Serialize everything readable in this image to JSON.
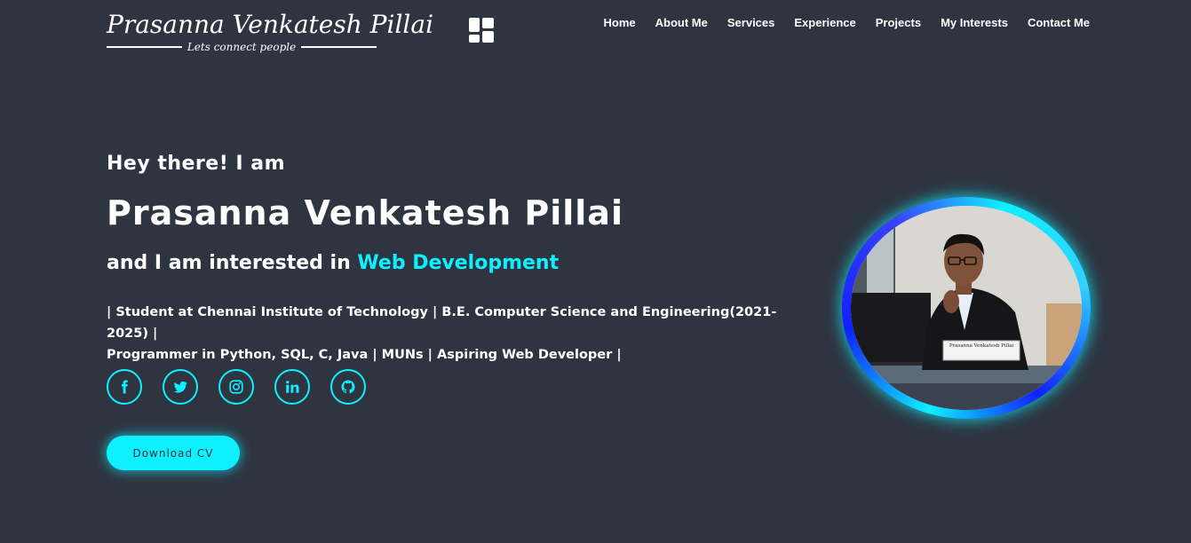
{
  "header": {
    "logo_title": "Prasanna Venkatesh Pillai",
    "logo_tagline": "Lets connect people",
    "menu_icon": "grid-menu-icon",
    "nav": [
      "Home",
      "About Me",
      "Services",
      "Experience",
      "Projects",
      "My Interests",
      "Contact Me"
    ]
  },
  "hero": {
    "greeting": "Hey there! I am",
    "name": "Prasanna Venkatesh Pillai",
    "interest_prefix": "and I am interested in",
    "interest_highlight": "Web Development",
    "bio_line1": "| Student at Chennai Institute of Technology | B.E. Computer Science and Engineering(2021-2025) |",
    "bio_line2": "Programmer in Python, SQL, C, Java | MUNs | Aspiring Web Developer |",
    "socials": [
      "facebook-icon",
      "twitter-icon",
      "instagram-icon",
      "linkedin-icon",
      "github-icon"
    ],
    "cv_button": "Download CV",
    "nameplate": "Prasanna Venkatesh Pillai"
  },
  "colors": {
    "background": "#2e3440",
    "accent": "#0ef0ff",
    "text": "#ffffff"
  }
}
